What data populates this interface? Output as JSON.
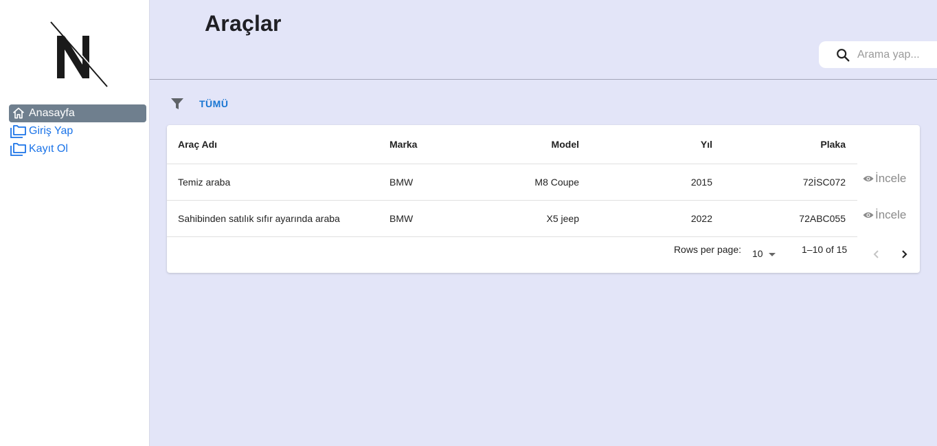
{
  "sidebar": {
    "items": [
      {
        "label": "Anasayfa",
        "icon": "home-icon",
        "active": true
      },
      {
        "label": "Giriş Yap",
        "icon": "folder-icon",
        "active": false
      },
      {
        "label": "Kayıt Ol",
        "icon": "folder-icon",
        "active": false
      }
    ]
  },
  "header": {
    "title": "Araçlar"
  },
  "search": {
    "placeholder": "Arama yap...",
    "icon": "search-icon"
  },
  "filter": {
    "icon": "filter-icon",
    "label": "TÜMÜ"
  },
  "table": {
    "columns": [
      "Araç Adı",
      "Marka",
      "Model",
      "Yıl",
      "Plaka"
    ],
    "rows": [
      {
        "name": "Temiz araba",
        "brand": "BMW",
        "model": "M8 Coupe",
        "year": "2015",
        "plate": "72İSC072",
        "action": "İncele"
      },
      {
        "name": "Sahibinden satılık sıfır ayarında araba",
        "brand": "BMW",
        "model": "X5 jeep",
        "year": "2022",
        "plate": "72ABC055",
        "action": "İncele"
      }
    ]
  },
  "pagination": {
    "rows_per_page_label": "Rows per page:",
    "rows_per_page_value": "10",
    "range_label": "1–10 of 15"
  },
  "colors": {
    "background": "#e3e5f8",
    "sidebar_active": "#6f7f8e",
    "link": "#1a73e8",
    "accent": "#1976d2"
  }
}
